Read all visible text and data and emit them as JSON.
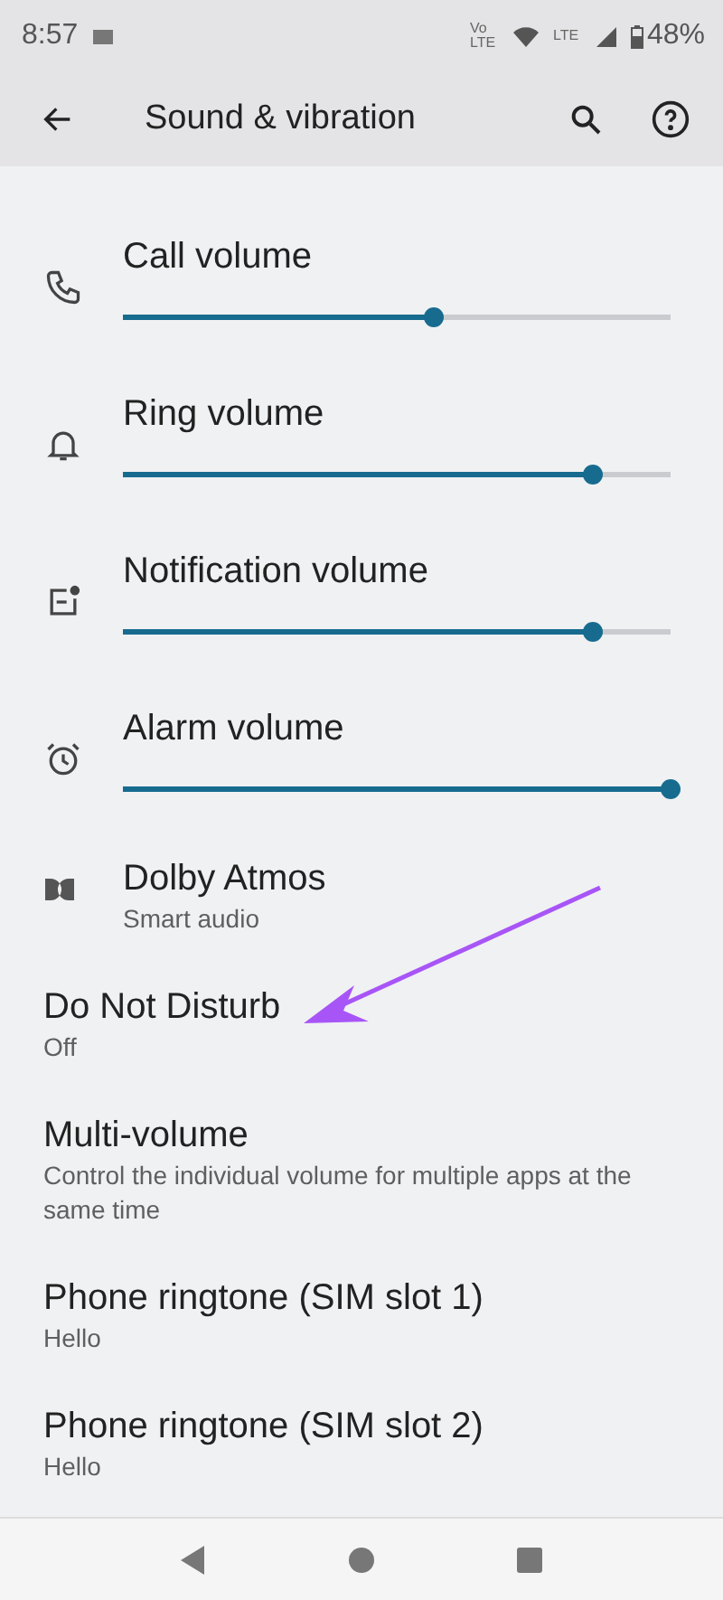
{
  "status_bar": {
    "time": "8:57",
    "volte": "Vo LTE",
    "lte": "LTE",
    "battery": "48%"
  },
  "app_bar": {
    "title": "Sound & vibration"
  },
  "volume_sliders": [
    {
      "label": "Call volume",
      "level": 0.57
    },
    {
      "label": "Ring volume",
      "level": 0.86
    },
    {
      "label": "Notification volume",
      "level": 0.86
    },
    {
      "label": "Alarm volume",
      "level": 1.0
    }
  ],
  "settings": [
    {
      "title": "Dolby Atmos",
      "summary": "Smart audio"
    },
    {
      "title": "Do Not Disturb",
      "summary": "Off"
    },
    {
      "title": "Multi-volume",
      "summary": "Control the individual volume for multiple apps at the same time"
    },
    {
      "title": "Phone ringtone (SIM slot 1)",
      "summary": "Hello"
    },
    {
      "title": "Phone ringtone (SIM slot 2)",
      "summary": "Hello"
    }
  ]
}
